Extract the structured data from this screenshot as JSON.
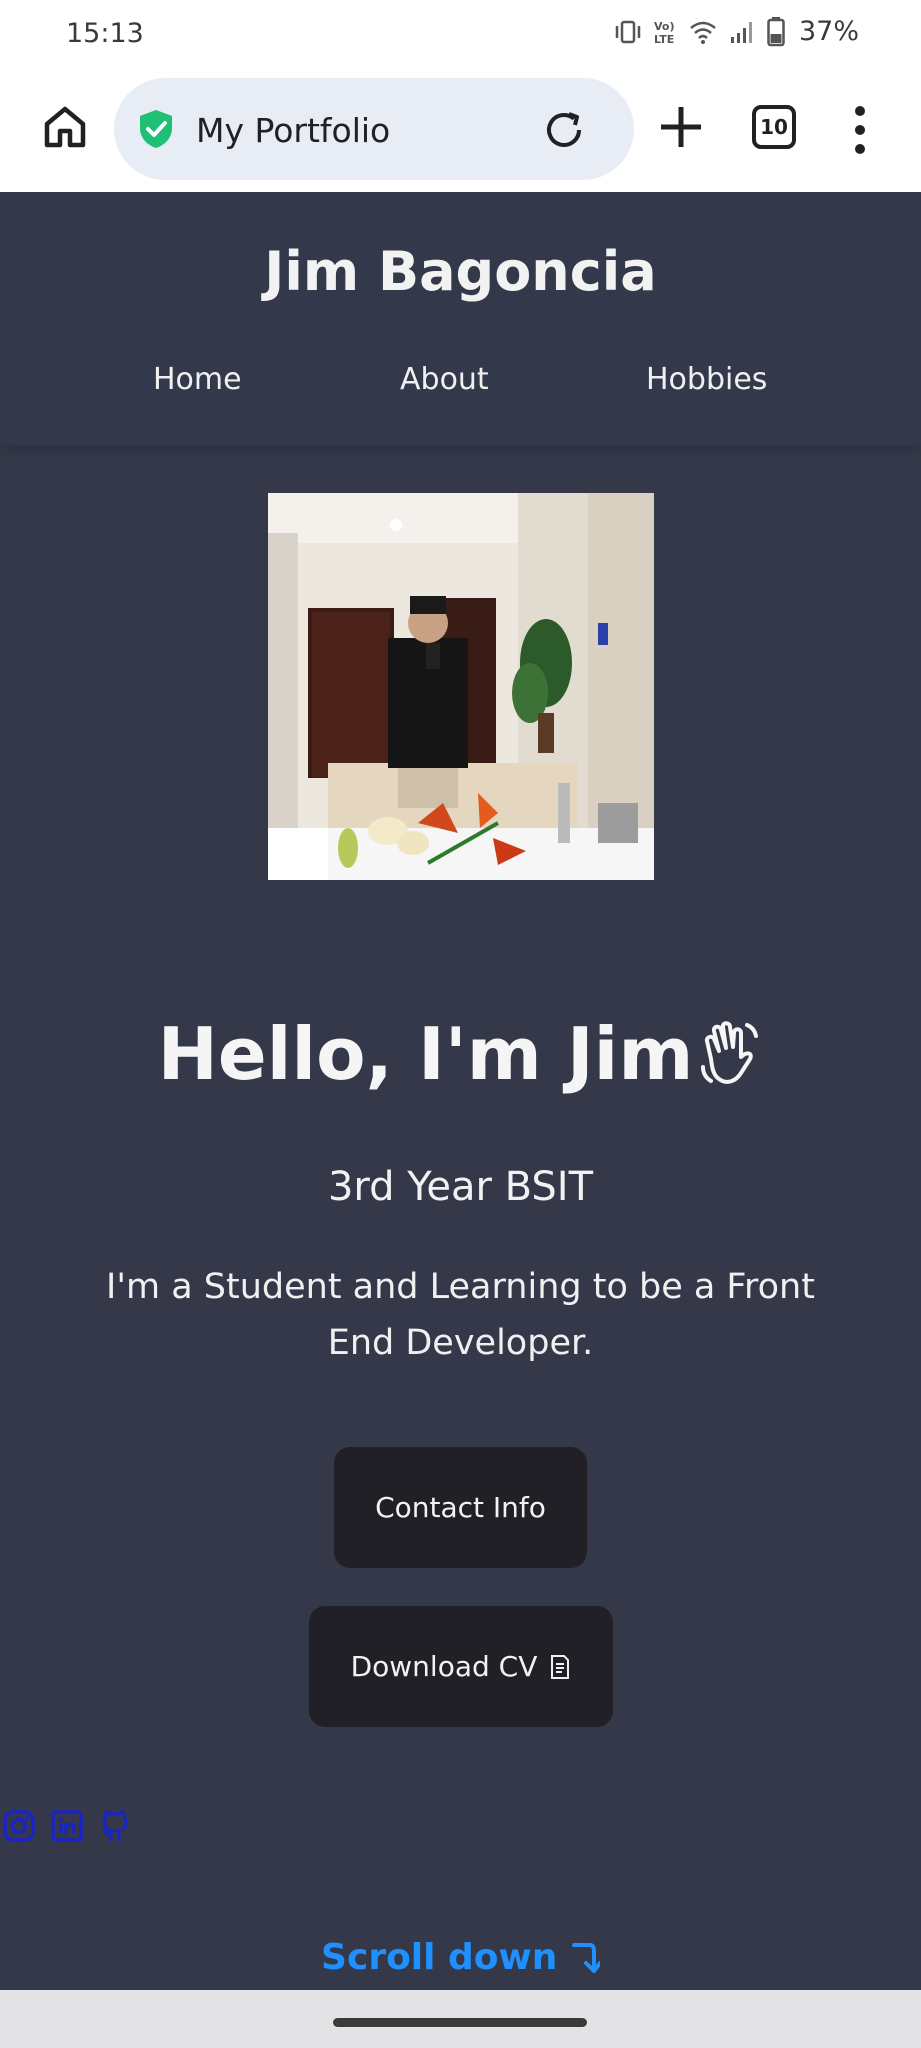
{
  "status_bar": {
    "time": "15:13",
    "network_label": "Vo) LTE",
    "battery_percent": "37%"
  },
  "browser": {
    "url_bar_title": "My Portfolio",
    "tab_count": "10",
    "icons": [
      "home-icon",
      "shield-check-icon",
      "reload-icon",
      "plus-icon",
      "tabs-icon",
      "more-vert-icon"
    ],
    "shield_color": "#1fbf75"
  },
  "site": {
    "name": "Jim Bagoncia",
    "nav": [
      "Home",
      "About",
      "Hobbies"
    ],
    "hero": {
      "greeting": "Hello, I'm Jim",
      "year_level": "3rd Year BSIT",
      "tagline": "I'm a Student and Learning to be a Front End Developer.",
      "contact_button": "Contact Info",
      "cv_button": "Download CV"
    },
    "socials": [
      "instagram-icon",
      "linkedin-icon",
      "github-icon"
    ],
    "scroll_label": "Scroll down",
    "colors": {
      "page_background": "#343849",
      "button_background": "#202026",
      "link_blue": "#1e90ff",
      "social_icon_blue": "#1a22c9"
    }
  }
}
